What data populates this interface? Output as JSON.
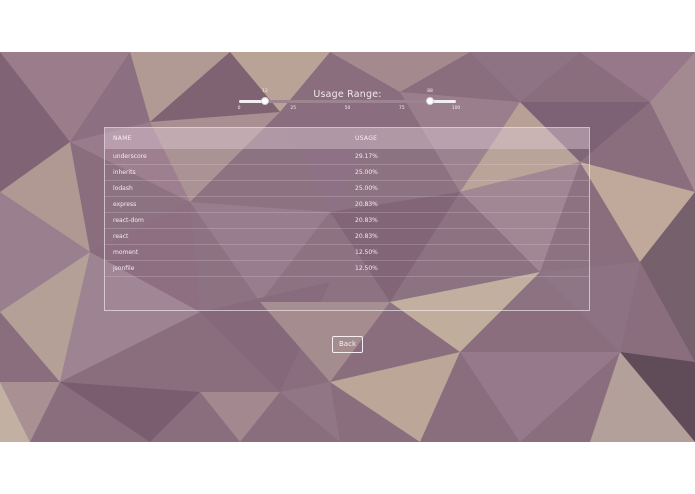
{
  "range": {
    "title": "Usage Range:",
    "min_value": 12,
    "max_value": 88,
    "min_label": "12",
    "max_label": "88",
    "ticks": [
      "0",
      "25",
      "50",
      "75",
      "100"
    ]
  },
  "table": {
    "headers": {
      "name": "NAME",
      "usage": "USAGE"
    },
    "rows": [
      {
        "name": "underscore",
        "usage": "29.17%"
      },
      {
        "name": "inherits",
        "usage": "25.00%"
      },
      {
        "name": "lodash",
        "usage": "25.00%"
      },
      {
        "name": "express",
        "usage": "20.83%"
      },
      {
        "name": "react-dom",
        "usage": "20.83%"
      },
      {
        "name": "react",
        "usage": "20.83%"
      },
      {
        "name": "moment",
        "usage": "12.50%"
      },
      {
        "name": "jsonfile",
        "usage": "12.50%"
      }
    ]
  },
  "back_button": {
    "label": "Back"
  },
  "colors": {
    "accent": "#f5eef2",
    "background": "#8a6e7e"
  }
}
